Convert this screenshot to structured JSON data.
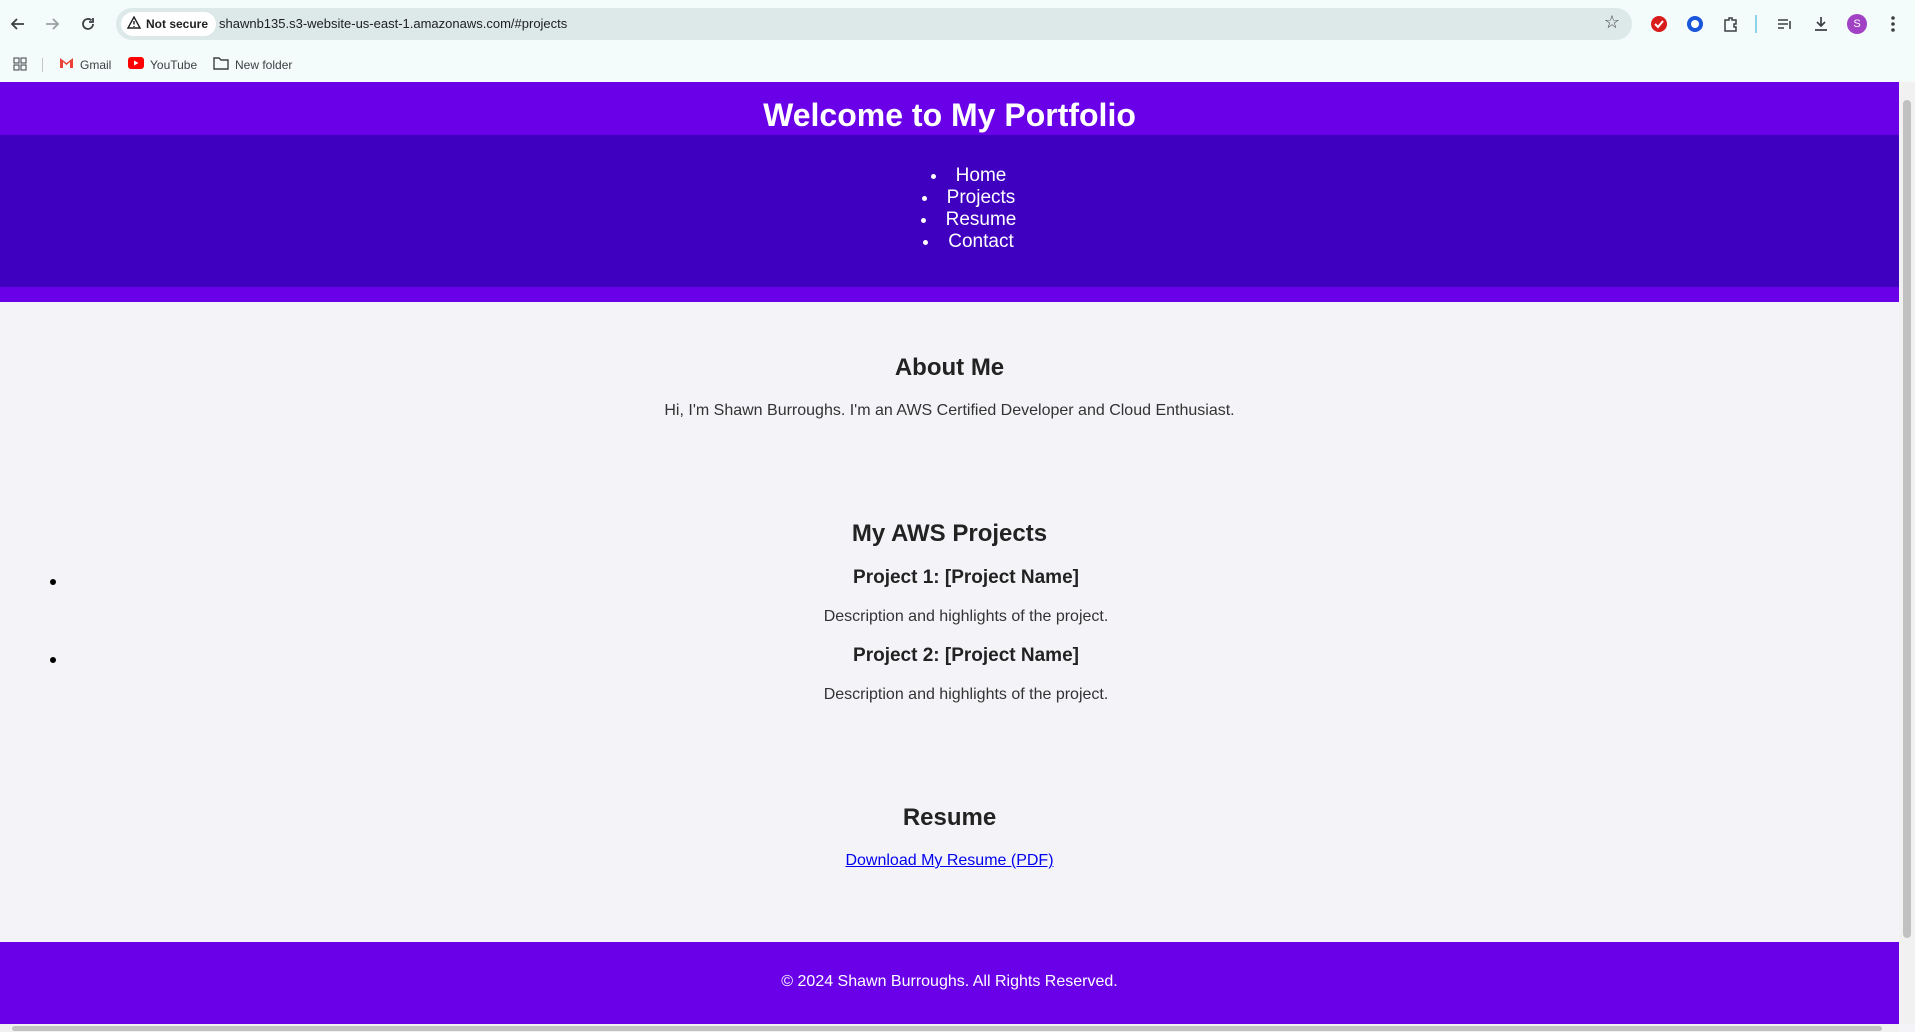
{
  "browser": {
    "security_label": "Not secure",
    "url": "shawnb135.s3-website-us-east-1.amazonaws.com/#projects",
    "profile_initial": "S",
    "bookmarks": [
      "Gmail",
      "YouTube",
      "New folder"
    ]
  },
  "header": {
    "title": "Welcome to My Portfolio",
    "nav": [
      "Home",
      "Projects",
      "Resume",
      "Contact"
    ]
  },
  "about": {
    "title": "About Me",
    "text": "Hi, I'm Shawn Burroughs. I'm an AWS Certified Developer and Cloud Enthusiast."
  },
  "projects": {
    "title": "My AWS Projects",
    "items": [
      {
        "name": "Project 1: [Project Name]",
        "description": "Description and highlights of the project."
      },
      {
        "name": "Project 2: [Project Name]",
        "description": "Description and highlights of the project."
      }
    ]
  },
  "resume": {
    "title": "Resume",
    "link_label": "Download My Resume (PDF)"
  },
  "footer": {
    "text": "© 2024 Shawn Burroughs. All Rights Reserved."
  },
  "colors": {
    "header_purple": "#6a00e8",
    "nav_purple": "#3f00c0",
    "page_bg": "#f4f4f8"
  }
}
